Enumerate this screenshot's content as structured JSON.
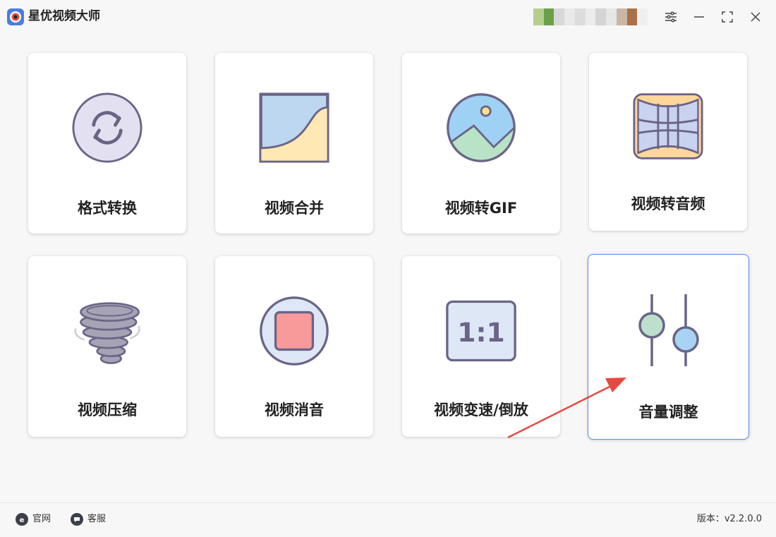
{
  "app": {
    "title": "星优视频大师"
  },
  "window_controls": [
    "settings-icon",
    "minimize-icon",
    "maximize-icon",
    "close-icon"
  ],
  "tools": [
    {
      "label": "格式转换",
      "icon": "convert-icon"
    },
    {
      "label": "视频合并",
      "icon": "merge-icon"
    },
    {
      "label": "视频转GIF",
      "icon": "gif-icon"
    },
    {
      "label": "视频转音频",
      "icon": "audio-extract-icon"
    },
    {
      "label": "视频压缩",
      "icon": "compress-icon"
    },
    {
      "label": "视频消音",
      "icon": "mute-icon"
    },
    {
      "label": "视频变速/倒放",
      "icon": "speed-icon"
    },
    {
      "label": "音量调整",
      "icon": "volume-adjust-icon",
      "selected": true
    }
  ],
  "icon_texts": {
    "speed_ratio": "1:1"
  },
  "footer": {
    "website_label": "官网",
    "support_label": "客服",
    "version_text": "版本：v2.2.0.0"
  },
  "colors": {
    "accent": "#5b8de8",
    "arrow": "#e8483f",
    "icon_stroke": "#6b6487"
  }
}
